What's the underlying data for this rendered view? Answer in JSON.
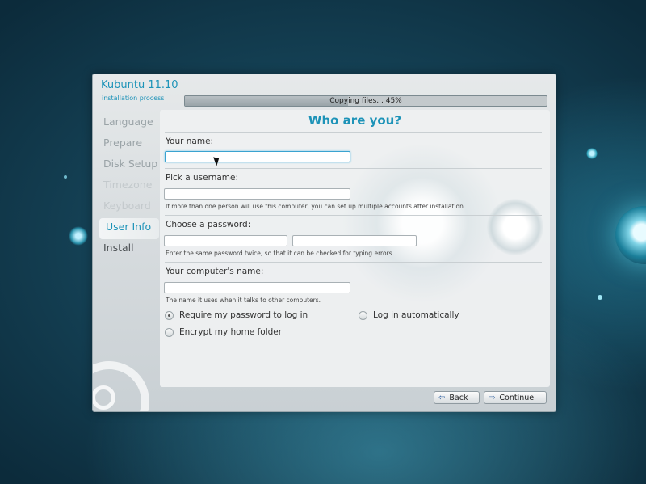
{
  "installer": {
    "title": "Kubuntu 11.10",
    "subtitle": "installation process",
    "progress": {
      "text": "Copying files... 45%",
      "percent": 45
    }
  },
  "steps": [
    {
      "label": "Language",
      "state": "done"
    },
    {
      "label": "Prepare",
      "state": "done"
    },
    {
      "label": "Disk Setup",
      "state": "done"
    },
    {
      "label": "Timezone",
      "state": "done"
    },
    {
      "label": "Keyboard",
      "state": "done"
    },
    {
      "label": "User Info",
      "state": "active"
    },
    {
      "label": "Install",
      "state": "pending"
    }
  ],
  "form": {
    "heading": "Who are you?",
    "name_label": "Your name:",
    "name_value": "",
    "username_label": "Pick a username:",
    "username_value": "",
    "username_hint": "If more than one person will use this computer, you can set up multiple accounts after installation.",
    "password_label": "Choose a password:",
    "password_hint": "Enter the same password twice, so that it can be checked for typing errors.",
    "computer_label": "Your computer's name:",
    "computer_value": "",
    "computer_hint": "The name it uses when it talks to other computers.",
    "opt_require_password": "Require my password to log in",
    "opt_login_auto": "Log in automatically",
    "opt_encrypt_home": "Encrypt my home folder"
  },
  "buttons": {
    "back": "Back",
    "continue": "Continue"
  },
  "colors": {
    "accent": "#1d93b8"
  }
}
